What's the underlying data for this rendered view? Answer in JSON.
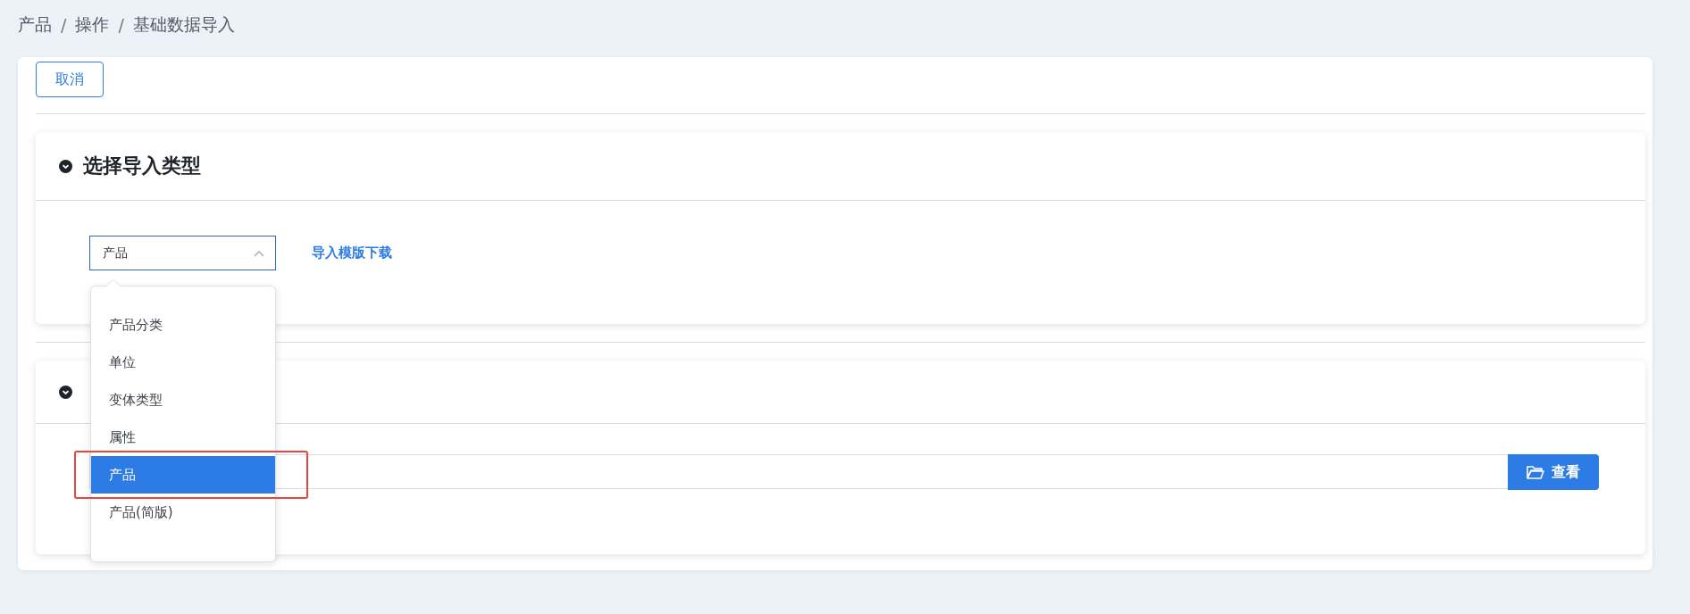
{
  "breadcrumb": {
    "items": [
      "产品",
      "操作",
      "基础数据导入"
    ],
    "separators": [
      "/",
      "/"
    ]
  },
  "cancel_button": "取消",
  "section_1": {
    "title": "选择导入类型",
    "expanded": true,
    "select": {
      "value": "产品",
      "open": true
    },
    "template_link": "导入模版下载"
  },
  "dropdown": {
    "options": [
      {
        "label": "产品分类",
        "selected": false
      },
      {
        "label": "单位",
        "selected": false
      },
      {
        "label": "变体类型",
        "selected": false
      },
      {
        "label": "属性",
        "selected": false
      },
      {
        "label": "产品",
        "selected": true
      },
      {
        "label": "产品(简版)",
        "selected": false
      }
    ]
  },
  "section_2": {
    "expanded": true,
    "browse_button": "查看"
  }
}
